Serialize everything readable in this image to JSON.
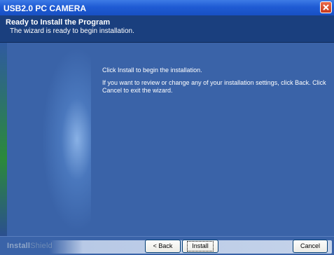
{
  "window": {
    "title": "USB2.0 PC CAMERA"
  },
  "header": {
    "title": "Ready to Install the Program",
    "subtitle": "The wizard is ready to begin installation."
  },
  "content": {
    "line1": "Click Install to begin the installation.",
    "line2": "If you want to review or change any of your installation settings, click Back. Click Cancel to exit the wizard."
  },
  "footer": {
    "brand_bold": "Install",
    "brand_light": "Shield",
    "back_label": "< Back",
    "install_label": "Install",
    "cancel_label": "Cancel"
  },
  "colors": {
    "titlebar": "#1f5bd4",
    "header": "#1a3f7e",
    "body": "#3a63a8"
  }
}
